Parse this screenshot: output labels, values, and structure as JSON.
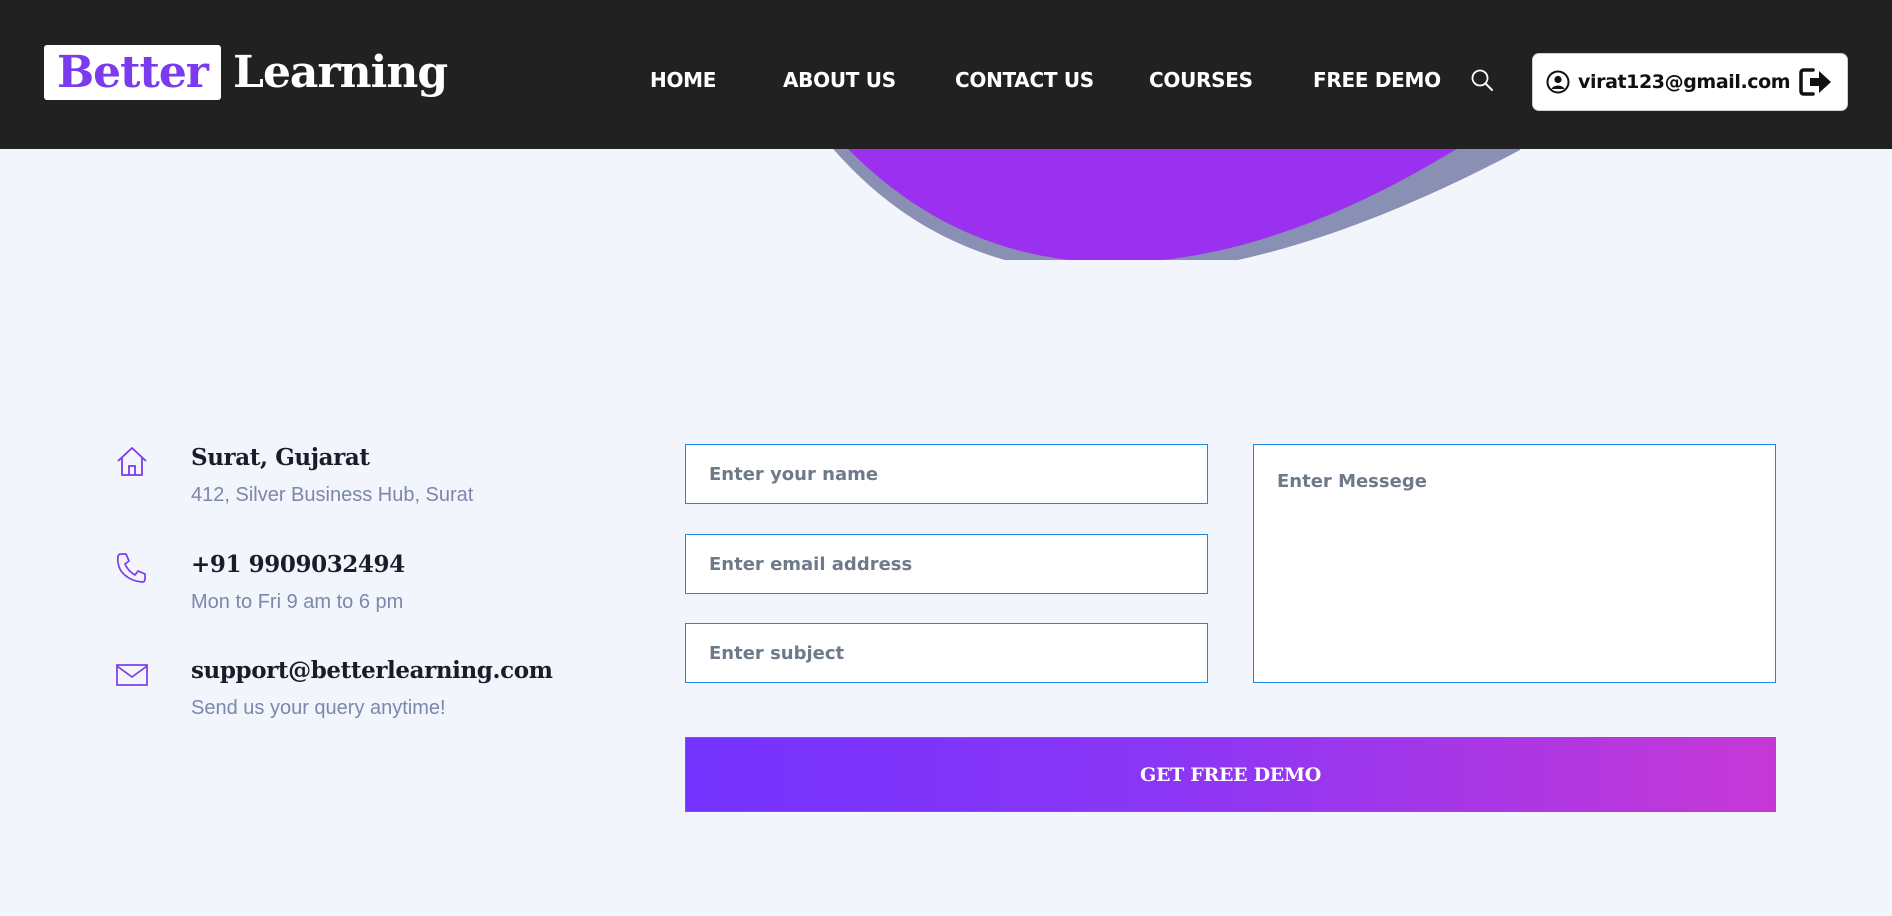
{
  "brand": {
    "logo_part1": "Better",
    "logo_part2": "Learning"
  },
  "nav": {
    "home": "HOME",
    "about": "ABOUT US",
    "contact": "CONTACT US",
    "courses": "COURSES",
    "free_demo": "FREE DEMO"
  },
  "user": {
    "email": "virat123@gmail.com"
  },
  "contact_info": [
    {
      "title": "Surat, Gujarat",
      "subtitle": "412, Silver Business Hub, Surat",
      "icon": "home-icon"
    },
    {
      "title": "+91 9909032494",
      "subtitle": "Mon to Fri 9 am to 6 pm",
      "icon": "phone-icon"
    },
    {
      "title": "support@betterlearning.com",
      "subtitle": "Send us your query anytime!",
      "icon": "mail-icon"
    }
  ],
  "form": {
    "name_placeholder": "Enter your name",
    "email_placeholder": "Enter email address",
    "subject_placeholder": "Enter subject",
    "message_placeholder": "Enter Messege",
    "submit_label": "GET FREE DEMO"
  },
  "colors": {
    "nav_bg": "#212121",
    "page_bg": "#f2f5fc",
    "accent": "#7b3aed",
    "blob": "#9b30f0",
    "field_border": "#1e88e5",
    "button_start": "#7433ff",
    "button_end": "#c638d6"
  }
}
